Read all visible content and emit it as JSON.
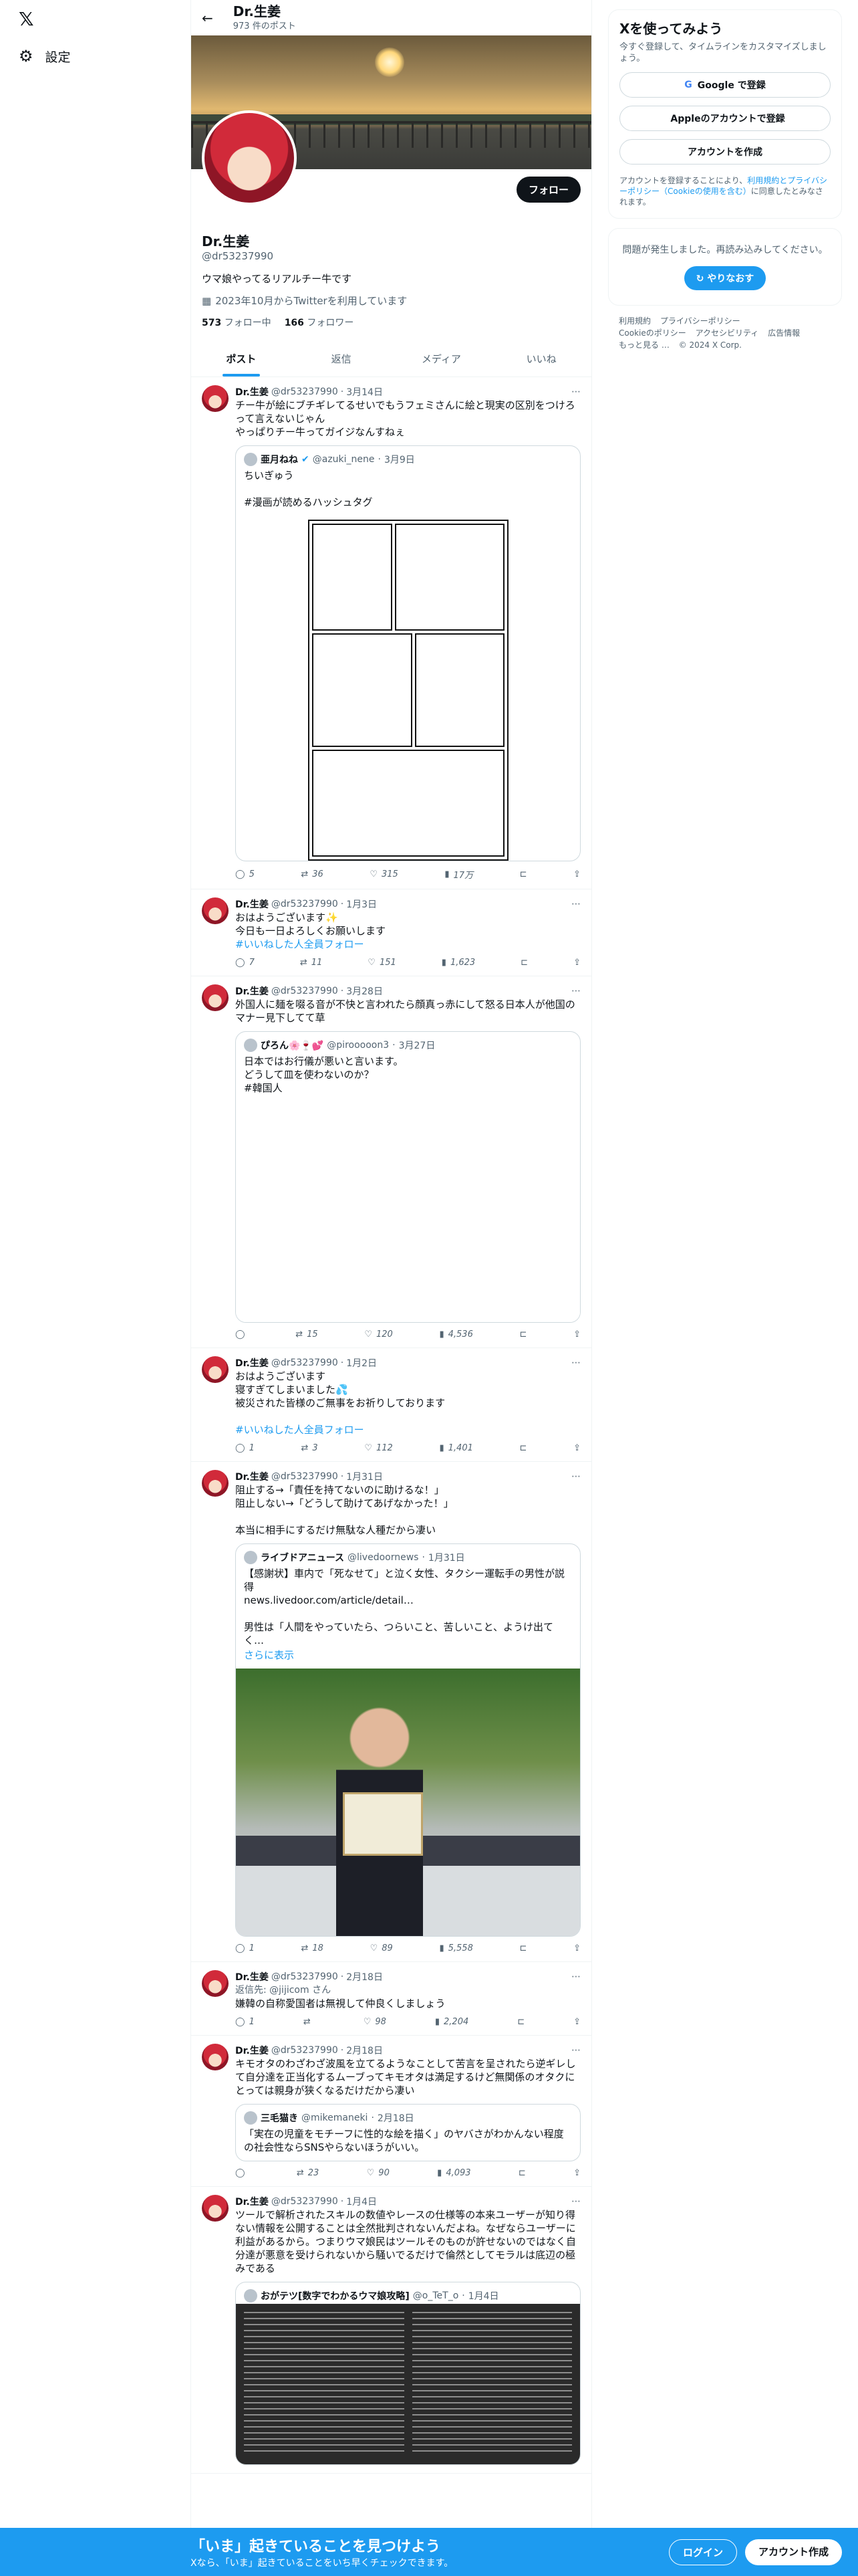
{
  "nav": {
    "logo": "𝕏",
    "settings_label": "設定"
  },
  "header": {
    "name": "Dr.生姜",
    "post_count": "973 件のポスト"
  },
  "profile": {
    "name": "Dr.生姜",
    "handle": "@dr53237990",
    "follow_label": "フォロー",
    "bio": "ウマ娘やってるリアルチー牛です",
    "joined": "2023年10月からTwitterを利用しています",
    "following_count": "573",
    "following_label": "フォロー中",
    "followers_count": "166",
    "followers_label": "フォロワー"
  },
  "tabs": [
    {
      "label": "ポスト"
    },
    {
      "label": "返信"
    },
    {
      "label": "メディア"
    },
    {
      "label": "いいね"
    }
  ],
  "tweets": [
    {
      "name": "Dr.生姜",
      "handle": "@dr53237990",
      "date": "3月14日",
      "text": "チー牛が絵にブチギレてるせいでもうフェミさんに絵と現実の区別をつけろって言えないじゃん\nやっぱりチー牛ってガイジなんすねぇ",
      "quote": {
        "name": "亜月ねね",
        "handle": "@azuki_nene",
        "date": "3月9日",
        "text": "ちいぎゅう\n\n#漫画が読めるハッシュタグ"
      },
      "replies": "5",
      "retweets": "36",
      "likes": "315",
      "views": "17万"
    },
    {
      "name": "Dr.生姜",
      "handle": "@dr53237990",
      "date": "1月3日",
      "text": "おはようございます✨\n今日も一日よろしくお願いします",
      "hashtag": "#いいねした人全員フォロー",
      "replies": "7",
      "retweets": "11",
      "likes": "151",
      "views": "1,623"
    },
    {
      "name": "Dr.生姜",
      "handle": "@dr53237990",
      "date": "3月28日",
      "text": "外国人に麺を啜る音が不快と言われたら顔真っ赤にして怒る日本人が他国のマナー見下してて草",
      "quote": {
        "name": "ぴろん🌸🍷💕",
        "handle": "@pirooooon3",
        "date": "3月27日",
        "text": "日本ではお行儀が悪いと言います。\nどうして皿を使わないのか？\n#韓国人"
      },
      "replies": "",
      "retweets": "15",
      "likes": "120",
      "views": "4,536"
    },
    {
      "name": "Dr.生姜",
      "handle": "@dr53237990",
      "date": "1月2日",
      "text": "おはようございます\n寝すぎてしまいました💦\n被災された皆様のご無事をお祈りしております",
      "hashtag": "#いいねした人全員フォロー",
      "replies": "1",
      "retweets": "3",
      "likes": "112",
      "views": "1,401"
    },
    {
      "name": "Dr.生姜",
      "handle": "@dr53237990",
      "date": "1月31日",
      "text": "阻止する→「責任を持てないのに助けるな！」\n阻止しない→「どうして助けてあげなかった！」\n\n本当に相手にするだけ無駄な人種だから凄い",
      "quote": {
        "name": "ライブドアニュース",
        "handle": "@livedoornews",
        "date": "1月31日",
        "text": "【感謝状】車内で「死なせて」と泣く女性、タクシー運転手の男性が説得\nnews.livedoor.com/article/detail…\n\n男性は「人間をやっていたら、つらいこと、苦しいこと、ようけ出てく…",
        "more": "さらに表示"
      },
      "replies": "1",
      "retweets": "18",
      "likes": "89",
      "views": "5,558"
    },
    {
      "name": "Dr.生姜",
      "handle": "@dr53237990",
      "date": "2月18日",
      "reply_to": "返信先: @jijicom さん",
      "text": "嫌韓の自称愛国者は無視して仲良くしましょう",
      "replies": "1",
      "retweets": "",
      "likes": "98",
      "views": "2,204"
    },
    {
      "name": "Dr.生姜",
      "handle": "@dr53237990",
      "date": "2月18日",
      "text": "キモオタのわざわざ波風を立てるようなことして苦言を呈されたら逆ギレして自分達を正当化するムーブってキモオタは満足するけど無関係のオタクにとっては親身が狭くなるだけだから凄い",
      "quote": {
        "name": "三毛猫き",
        "handle": "@mikemaneki",
        "date": "2月18日",
        "text": "「実在の児童をモチーフに性的な絵を描く」のヤバさがわかんない程度の社会性ならSNSやらないほうがいい。"
      },
      "replies": "",
      "retweets": "23",
      "likes": "90",
      "views": "4,093"
    },
    {
      "name": "Dr.生姜",
      "handle": "@dr53237990",
      "date": "1月4日",
      "text": "ツールで解析されたスキルの数値やレースの仕様等の本来ユーザーが知り得ない情報を公開することは全然批判されないんだよね。なぜならユーザーに利益があるから。つまりウマ娘民はツールそのものが許せないのではなく自分達が悪意を受けられないから騒いでるだけで倫然としてモラルは底辺の極みである",
      "quote": {
        "name": "おがテツ[数字でわかるウマ娘攻略]",
        "handle": "@o_TeT_o",
        "date": "1月4日",
        "text": ""
      }
    }
  ],
  "sidebar": {
    "title": "Xを使ってみよう",
    "subtitle": "今すぐ登録して、タイムラインをカスタマイズしましょう。",
    "google_label": "Google で登録",
    "apple_label": "Appleのアカウントで登録",
    "create_label": "アカウントを作成",
    "legal_prefix": "アカウントを登録することにより、",
    "legal_links": "利用規約とプライバシーポリシー（Cookieの使用を含む）",
    "legal_suffix": "に同意したとみなされます。",
    "error_text": "問題が発生しました。再読み込みしてください。",
    "retry_label": "やりなおす",
    "footer": [
      "利用規約",
      "プライバシーポリシー",
      "Cookieのポリシー",
      "アクセシビリティ",
      "広告情報",
      "もっと見る …",
      "© 2024 X Corp."
    ]
  },
  "bottom": {
    "headline": "「いま」起きていることを見つけよう",
    "subline": "Xなら、「いま」起きていることをいち早くチェックできます。",
    "login_label": "ログイン",
    "signup_label": "アカウント作成"
  }
}
